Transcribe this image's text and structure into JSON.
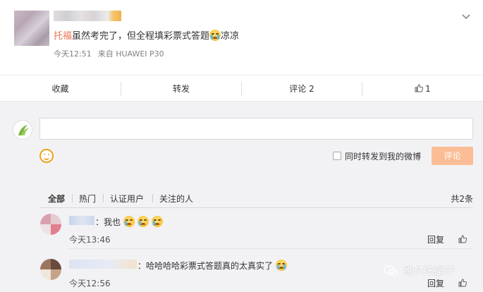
{
  "post": {
    "mention": "托福",
    "text_before_emoji": "虽然考完了，但全程填彩票式答题",
    "text_after_emoji": "凉凉",
    "time": "今天12:51",
    "source": "来自 HUAWEI P30"
  },
  "actions": {
    "favorite": "收藏",
    "repost": "转发",
    "comment": "评论 2",
    "like_count": "1"
  },
  "composer": {
    "input_value": "",
    "forward_checkbox_label": "同时转发到我的微博",
    "forward_checked": false,
    "submit_label": "评论"
  },
  "filters": {
    "items": [
      "全部",
      "热门",
      "认证用户",
      "关注的人"
    ],
    "active": "全部",
    "total": "共2条"
  },
  "comments": [
    {
      "text": "：我也",
      "emoji_count": 3,
      "time": "今天13:46",
      "reply": "回复"
    },
    {
      "text": "：哈哈哈哈彩票式答题真的太真实了",
      "emoji_count": 1,
      "time": "今天12:56",
      "reply": "回复"
    }
  ],
  "watermark": {
    "text": "维夕托福TF",
    "icon": "wechat-icon"
  },
  "colors": {
    "mention": "#eb7350",
    "submit_bg": "#fbbd95",
    "page_bg": "#f2f2f5",
    "emoji_accent": "#f0a21c"
  }
}
